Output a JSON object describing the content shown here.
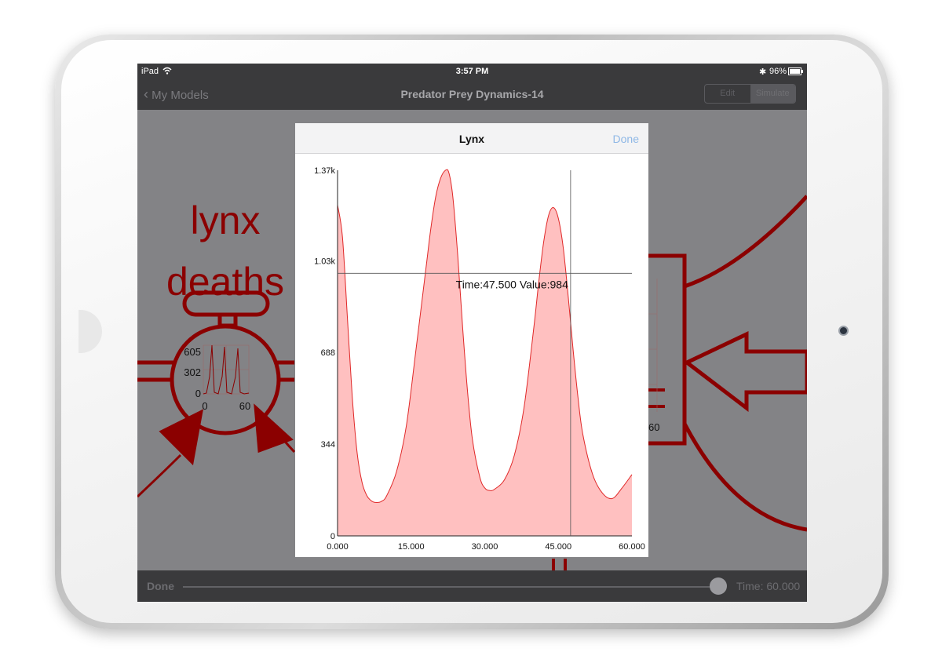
{
  "status_bar": {
    "device": "iPad",
    "time": "3:57 PM",
    "battery": "96%"
  },
  "nav": {
    "back_label": "My Models",
    "title": "Predator Prey Dynamics-14",
    "segments": [
      "Edit",
      "Simulate"
    ],
    "active_segment": "Simulate"
  },
  "background": {
    "flow_label_line1": "lynx",
    "flow_label_line2": "deaths",
    "mini_chart": {
      "y_ticks": [
        "605",
        "302",
        "0"
      ],
      "x_ticks": [
        "0",
        "60"
      ]
    },
    "right_partial_tick": "60",
    "accent_color": "#8b0000"
  },
  "modal": {
    "title": "Lynx",
    "done_label": "Done",
    "tooltip": "Time:47.500 Value:984",
    "crosshair": {
      "time": 47.5,
      "value": 984
    }
  },
  "bottom": {
    "done_label": "Done",
    "time_label": "Time: 60.000",
    "slider_fraction": 1.0
  },
  "chart_data": {
    "type": "area",
    "title": "Lynx",
    "y_tick_labels": [
      "0",
      "344",
      "688",
      "1.03k",
      "1.37k"
    ],
    "x_tick_labels": [
      "0.000",
      "15.000",
      "30.000",
      "45.000",
      "60.000"
    ],
    "xlim": [
      0,
      60
    ],
    "ylim": [
      0,
      1370
    ],
    "fill_color": "#ffc0c0",
    "line_color": "#e02828",
    "series": [
      {
        "x": [
          0,
          1,
          2,
          3,
          4,
          5,
          6,
          7,
          8,
          9,
          10,
          12,
          14,
          16,
          18,
          19,
          20,
          21,
          22,
          22.7,
          23.5,
          24.5,
          25.5,
          26.5,
          27.5,
          29,
          30,
          31,
          32,
          34,
          36,
          38,
          40,
          41,
          42,
          43,
          44,
          45,
          46,
          47,
          48,
          49,
          50,
          52,
          54,
          56,
          58,
          60
        ],
        "y": [
          1240,
          1120,
          820,
          520,
          310,
          200,
          150,
          130,
          125,
          130,
          150,
          240,
          410,
          700,
          1000,
          1150,
          1270,
          1340,
          1370,
          1360,
          1270,
          1050,
          780,
          540,
          360,
          220,
          180,
          170,
          175,
          210,
          300,
          480,
          780,
          950,
          1100,
          1200,
          1230,
          1190,
          1080,
          900,
          700,
          520,
          380,
          230,
          160,
          140,
          180,
          230
        ]
      }
    ]
  }
}
